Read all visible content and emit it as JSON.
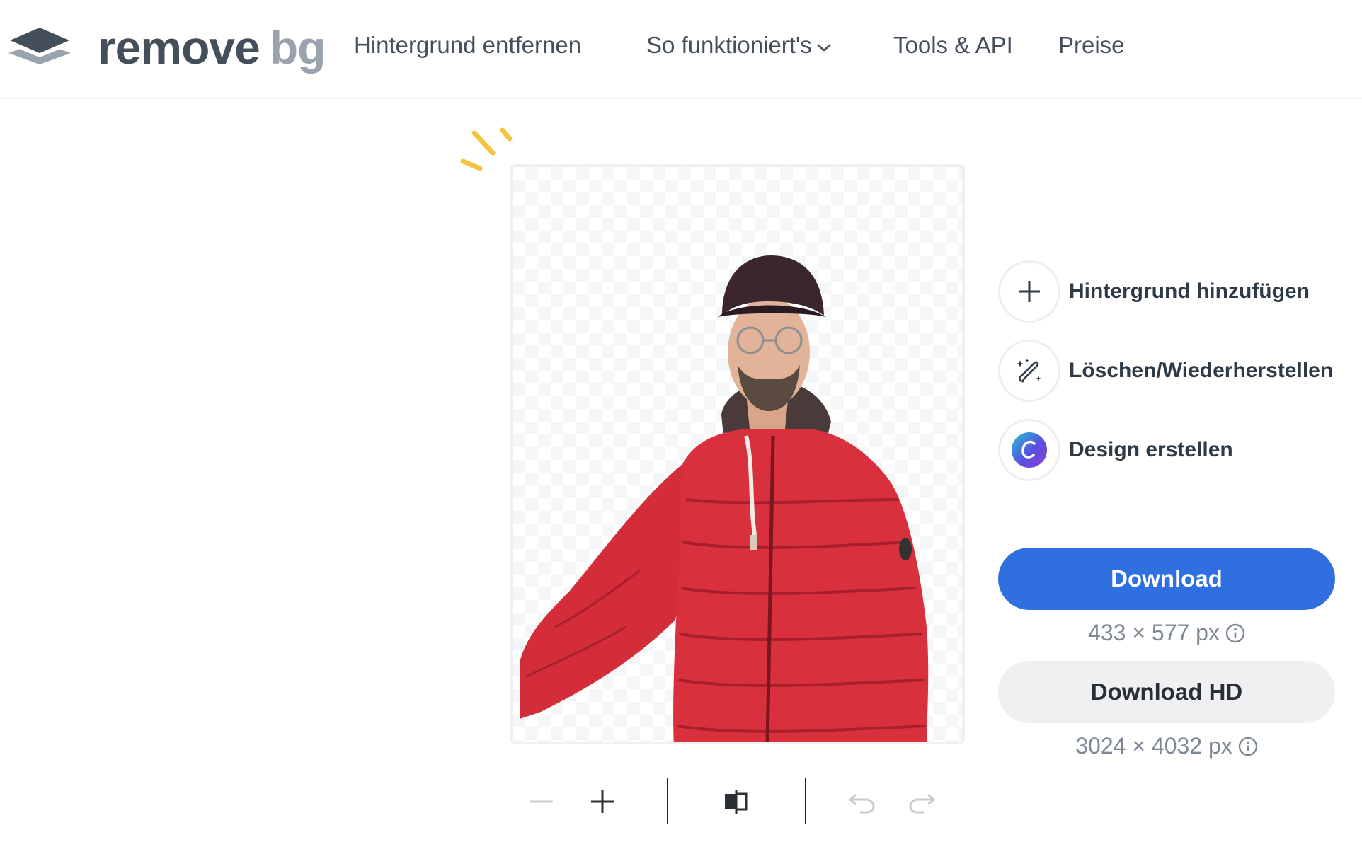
{
  "brand": {
    "name_part1": "remove",
    "name_part2": "bg",
    "logo_icon": "layers-logo-icon"
  },
  "nav": {
    "items": [
      {
        "label": "Hintergrund entfernen"
      },
      {
        "label": "So funktioniert's",
        "icon": "chevron-down-icon"
      },
      {
        "label": "Tools & API"
      },
      {
        "label": "Preise"
      }
    ]
  },
  "preview": {
    "image_description_icon": "person-cutout-image",
    "background": "transparent-checkerboard"
  },
  "actions": [
    {
      "label": "Hintergrund hinzufügen",
      "icon": "plus-icon"
    },
    {
      "label": "Löschen/Wiederherstellen",
      "icon": "magic-brush-icon"
    },
    {
      "label": "Design erstellen",
      "icon": "canva-icon"
    }
  ],
  "download": {
    "label": "Download",
    "size": "433 × 577 px",
    "hd_label": "Download HD",
    "hd_size": "3024 × 4032 px",
    "info_icon": "info-icon"
  },
  "toolbar": {
    "icons": [
      "zoom-out-icon",
      "zoom-in-icon",
      "compare-icon",
      "undo-icon",
      "redo-icon"
    ]
  },
  "colors": {
    "accent": "#2f6fdf",
    "text": "#454f5b",
    "sparkle": "#f5c542",
    "jacket": "#d8303c"
  }
}
